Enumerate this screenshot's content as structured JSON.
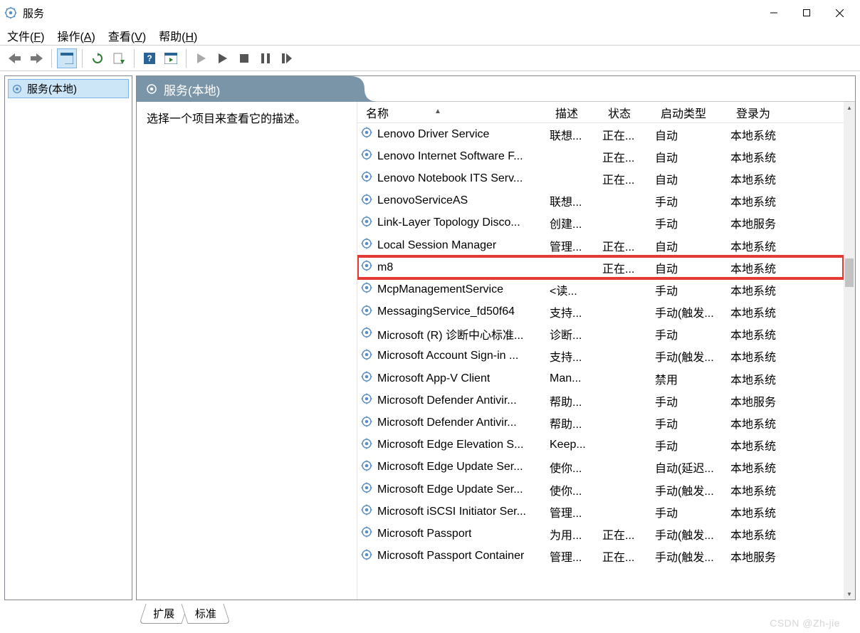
{
  "window": {
    "title": "服务"
  },
  "menubar": {
    "file": "文件(F)",
    "file_key": "F",
    "action": "操作(A)",
    "action_key": "A",
    "view": "查看(V)",
    "view_key": "V",
    "help": "帮助(H)",
    "help_key": "H"
  },
  "tree": {
    "root": "服务(本地)"
  },
  "panel": {
    "header": "服务(本地)",
    "description_prompt": "选择一个项目来查看它的描述。"
  },
  "columns": {
    "name": "名称",
    "desc": "描述",
    "status": "状态",
    "startup": "启动类型",
    "logon": "登录为"
  },
  "services": [
    {
      "name": "Lenovo Driver Service",
      "desc": "联想...",
      "status": "正在...",
      "startup": "自动",
      "logon": "本地系统"
    },
    {
      "name": "Lenovo Internet Software F...",
      "desc": "",
      "status": "正在...",
      "startup": "自动",
      "logon": "本地系统"
    },
    {
      "name": "Lenovo Notebook ITS Serv...",
      "desc": "",
      "status": "正在...",
      "startup": "自动",
      "logon": "本地系统"
    },
    {
      "name": "LenovoServiceAS",
      "desc": "联想...",
      "status": "",
      "startup": "手动",
      "logon": "本地系统"
    },
    {
      "name": "Link-Layer Topology Disco...",
      "desc": "创建...",
      "status": "",
      "startup": "手动",
      "logon": "本地服务"
    },
    {
      "name": "Local Session Manager",
      "desc": "管理...",
      "status": "正在...",
      "startup": "自动",
      "logon": "本地系统"
    },
    {
      "name": "m8",
      "desc": "",
      "status": "正在...",
      "startup": "自动",
      "logon": "本地系统",
      "highlight": true
    },
    {
      "name": "McpManagementService",
      "desc": "<读...",
      "status": "",
      "startup": "手动",
      "logon": "本地系统"
    },
    {
      "name": "MessagingService_fd50f64",
      "desc": "支持...",
      "status": "",
      "startup": "手动(触发...",
      "logon": "本地系统"
    },
    {
      "name": "Microsoft (R) 诊断中心标准...",
      "desc": "诊断...",
      "status": "",
      "startup": "手动",
      "logon": "本地系统"
    },
    {
      "name": "Microsoft Account Sign-in ...",
      "desc": "支持...",
      "status": "",
      "startup": "手动(触发...",
      "logon": "本地系统"
    },
    {
      "name": "Microsoft App-V Client",
      "desc": "Man...",
      "status": "",
      "startup": "禁用",
      "logon": "本地系统"
    },
    {
      "name": "Microsoft Defender Antivir...",
      "desc": "帮助...",
      "status": "",
      "startup": "手动",
      "logon": "本地服务"
    },
    {
      "name": "Microsoft Defender Antivir...",
      "desc": "帮助...",
      "status": "",
      "startup": "手动",
      "logon": "本地系统"
    },
    {
      "name": "Microsoft Edge Elevation S...",
      "desc": "Keep...",
      "status": "",
      "startup": "手动",
      "logon": "本地系统"
    },
    {
      "name": "Microsoft Edge Update Ser...",
      "desc": "使你...",
      "status": "",
      "startup": "自动(延迟...",
      "logon": "本地系统"
    },
    {
      "name": "Microsoft Edge Update Ser...",
      "desc": "使你...",
      "status": "",
      "startup": "手动(触发...",
      "logon": "本地系统"
    },
    {
      "name": "Microsoft iSCSI Initiator Ser...",
      "desc": "管理...",
      "status": "",
      "startup": "手动",
      "logon": "本地系统"
    },
    {
      "name": "Microsoft Passport",
      "desc": "为用...",
      "status": "正在...",
      "startup": "手动(触发...",
      "logon": "本地系统"
    },
    {
      "name": "Microsoft Passport Container",
      "desc": "管理...",
      "status": "正在...",
      "startup": "手动(触发...",
      "logon": "本地服务"
    }
  ],
  "tabs": {
    "extended": "扩展",
    "standard": "标准"
  },
  "watermark": "CSDN @Zh-jie"
}
